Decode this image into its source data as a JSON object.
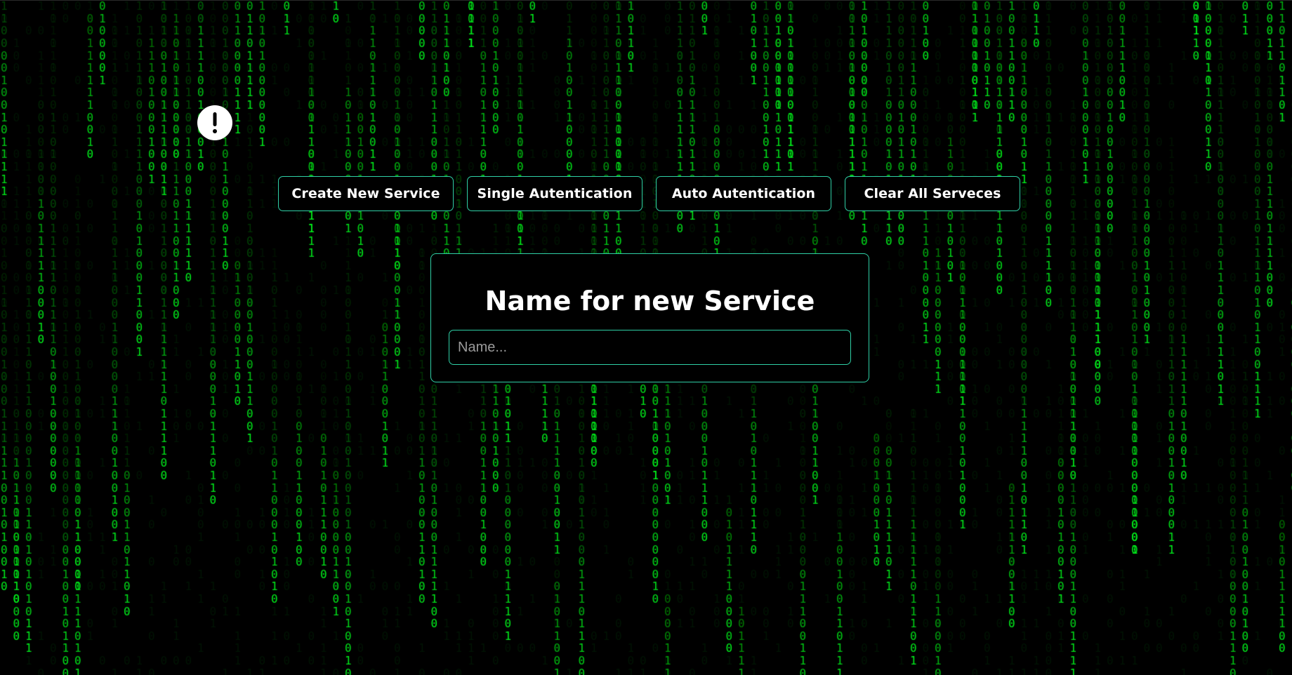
{
  "alert": {
    "icon": "exclamation-icon"
  },
  "toolbar": {
    "create_label": "Create New Service",
    "single_label": "Single Autentication",
    "auto_label": "Auto Autentication",
    "clear_label": "Clear All Serveces"
  },
  "modal": {
    "title": "Name for new Service",
    "input_placeholder": "Name...",
    "input_value": ""
  },
  "colors": {
    "background": "#000000",
    "matrix_green": "#00ff33",
    "accent_border": "#2fd0a6",
    "text": "#ffffff"
  },
  "background_effect": {
    "type": "matrix-binary-rain",
    "glyphs": [
      "0",
      "1"
    ]
  }
}
